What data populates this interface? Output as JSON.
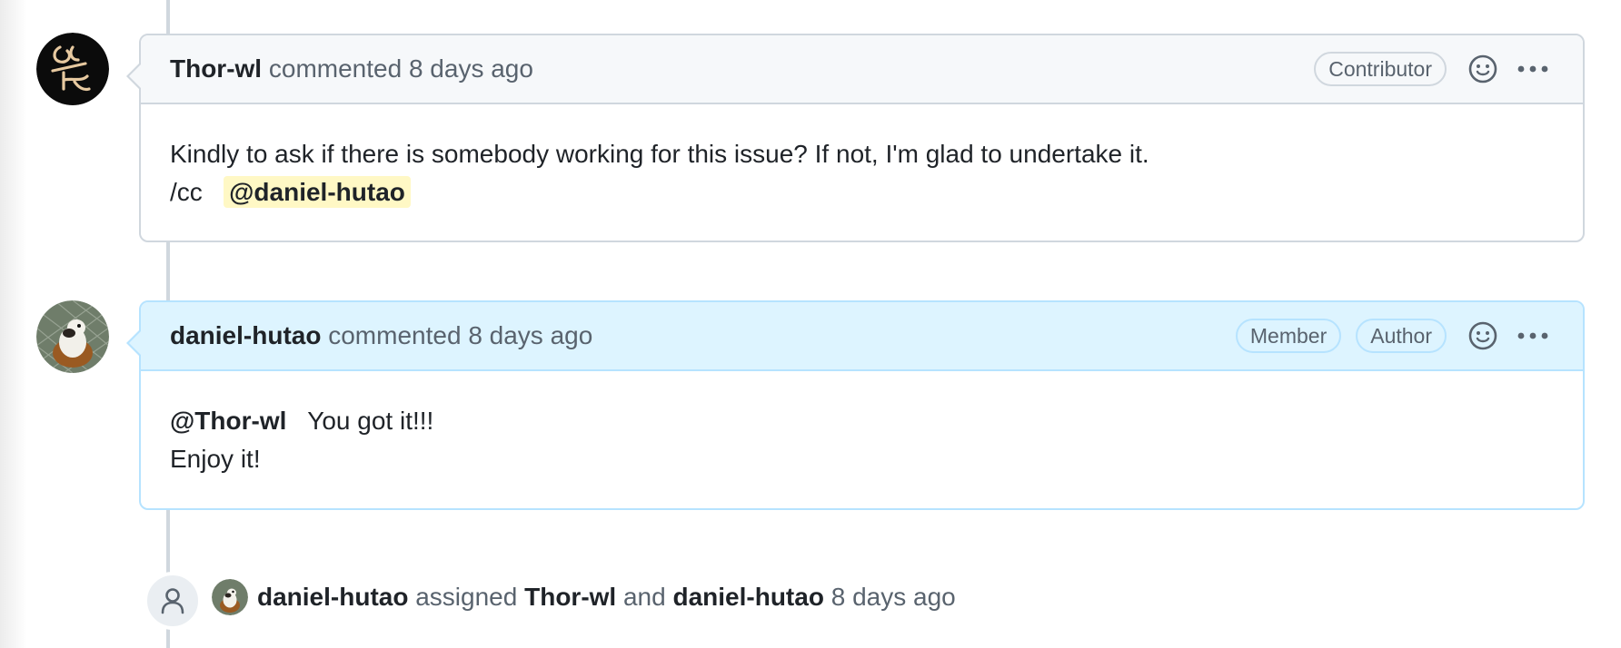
{
  "comments": [
    {
      "author": "Thor-wl",
      "action": "commented",
      "time": "8 days ago",
      "badges": [
        "Contributor"
      ],
      "body_line1": "Kindly to ask if there is somebody working for this issue? If not, I'm glad to undertake it.",
      "body_line2_prefix": "/cc",
      "body_line2_mention": "@daniel-hutao",
      "avatar_icon": "thor-wl-avatar"
    },
    {
      "author": "daniel-hutao",
      "action": "commented",
      "time": "8 days ago",
      "badges": [
        "Member",
        "Author"
      ],
      "body_line1_mention": "@Thor-wl",
      "body_line1_text": "You got it!!!",
      "body_line2": "Enjoy it!",
      "avatar_icon": "daniel-hutao-avatar"
    }
  ],
  "event": {
    "icon": "person-icon",
    "actor": "daniel-hutao",
    "verb": "assigned",
    "assignee1": "Thor-wl",
    "conjunction": "and",
    "assignee2": "daniel-hutao",
    "time": "8 days ago"
  },
  "icons": {
    "emoji_reaction": "smiley-icon",
    "more_actions": "kebab-horizontal-icon"
  },
  "colors": {
    "header_bg": "#f6f8fa",
    "author_header_bg": "#ddf4ff",
    "border": "#d0d7de",
    "author_border": "#b6e3ff",
    "mention_highlight": "#fff8c5",
    "muted_text": "#59636e"
  }
}
